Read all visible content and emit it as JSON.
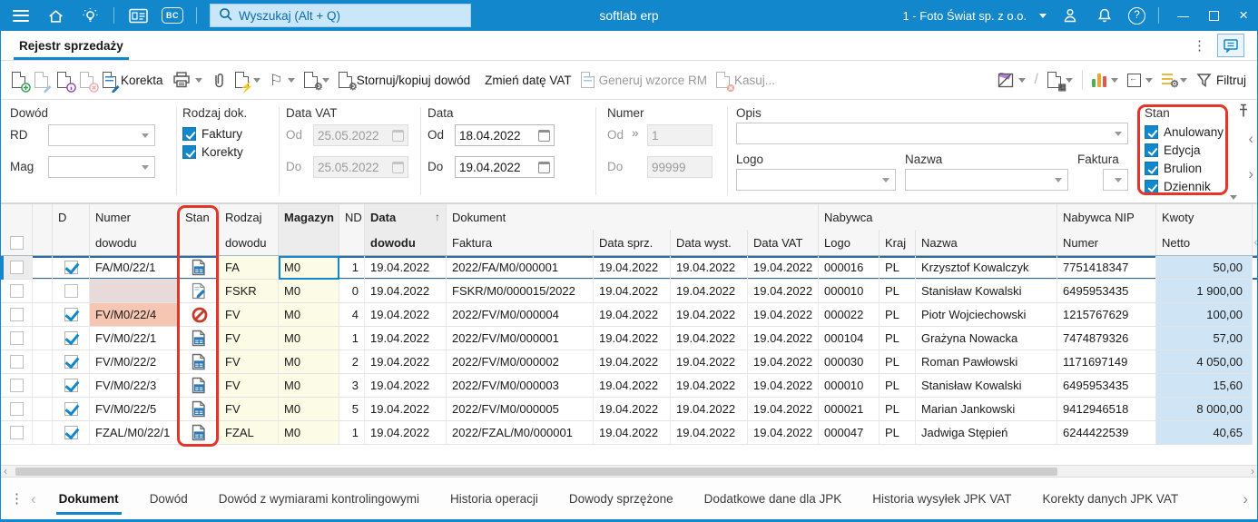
{
  "topbar": {
    "brand": "softlab erp",
    "search": {
      "placeholder": "Wyszukaj (Alt + Q)"
    },
    "company": "1 - Foto Świat sp. z o.o."
  },
  "icons": {
    "dots": "⋮",
    "chevron_left": "‹",
    "chevron_right": "›",
    "minimize": "—",
    "close": "×",
    "question": "?",
    "double_right": "»",
    "sort_asc": "↑",
    "flag": "⚐",
    "gear": "⚙",
    "bolt": "⚡",
    "grid_badge": "▦"
  },
  "tabstrip": {
    "title": "Rejestr sprzedaży"
  },
  "toolbar": {
    "korekta": "Korekta",
    "stornuj": "Stornuj/kopiuj dowód",
    "zmien_date_vat": "Zmień datę VAT",
    "generuj_wzorce": "Generuj wzorce RM",
    "kasuj": "Kasuj...",
    "filtruj": "Filtruj"
  },
  "filters": {
    "dowod": {
      "title": "Dowód",
      "rd_label": "RD",
      "mag_label": "Mag"
    },
    "rodzaj_dok": {
      "title": "Rodzaj dok.",
      "options": [
        "Faktury",
        "Korekty"
      ]
    },
    "data_vat": {
      "title": "Data VAT",
      "od_label": "Od",
      "do_label": "Do",
      "od": "25.05.2022",
      "do": "25.05.2022"
    },
    "data": {
      "title": "Data",
      "od_label": "Od",
      "do_label": "Do",
      "od": "18.04.2022",
      "do": "19.04.2022"
    },
    "numer": {
      "title": "Numer",
      "od_label": "Od",
      "do_label": "Do",
      "od": "1",
      "do": "99999"
    },
    "opis": {
      "title": "Opis"
    },
    "logo": {
      "title": "Logo"
    },
    "nazwa": {
      "title": "Nazwa"
    },
    "faktura": {
      "title": "Faktura"
    },
    "stan": {
      "title": "Stan",
      "options": [
        "Anulowany",
        "Edycja",
        "Brulion",
        "Dziennik"
      ]
    }
  },
  "table": {
    "headers": {
      "d": "D",
      "numer_1": "Numer",
      "numer_2": "dowodu",
      "stan": "Stan",
      "rodzaj_1": "Rodzaj",
      "rodzaj_2": "dowodu",
      "magazyn": "Magazyn",
      "nd": "ND",
      "data_1": "Data",
      "data_2": "dowodu",
      "dokument": "Dokument",
      "faktura": "Faktura",
      "data_sprz": "Data sprz.",
      "data_wyst": "Data wyst.",
      "data_vat": "Data VAT",
      "nabywca": "Nabywca",
      "logo": "Logo",
      "kraj": "Kraj",
      "nazwa": "Nazwa",
      "nabywca_nip": "Nabywca NIP",
      "nip_numer": "Numer",
      "kwoty": "Kwoty",
      "netto": "Netto"
    },
    "rows": [
      {
        "d": true,
        "numer": "FA/M0/22/1",
        "numer_bg": "",
        "stan": "dziennik",
        "rodzaj": "FA",
        "magazyn": "M0",
        "nd": "1",
        "data": "19.04.2022",
        "faktura": "2022/FA/M0/000001",
        "data_sprz": "19.04.2022",
        "data_wyst": "19.04.2022",
        "data_vat": "19.04.2022",
        "logo": "000016",
        "kraj": "PL",
        "nazwa": "Krzysztof Kowalczyk",
        "nip": "7751418347",
        "netto": "50,00",
        "selected": true,
        "magazyn_focus": true
      },
      {
        "d": false,
        "numer": "",
        "numer_bg": "rose",
        "stan": "edycja",
        "rodzaj": "FSKR",
        "magazyn": "M0",
        "nd": "0",
        "data": "19.04.2022",
        "faktura": "FSKR/M0/000015/2022",
        "data_sprz": "19.04.2022",
        "data_wyst": "19.04.2022",
        "data_vat": "19.04.2022",
        "logo": "000010",
        "kraj": "PL",
        "nazwa": "Stanisław Kowalski",
        "nip": "6495953435",
        "netto": "1 900,00"
      },
      {
        "d": true,
        "numer": "FV/M0/22/4",
        "numer_bg": "salmon",
        "stan": "anulowany",
        "rodzaj": "FV",
        "magazyn": "M0",
        "nd": "4",
        "data": "19.04.2022",
        "faktura": "2022/FV/M0/000004",
        "data_sprz": "19.04.2022",
        "data_wyst": "19.04.2022",
        "data_vat": "19.04.2022",
        "logo": "000022",
        "kraj": "PL",
        "nazwa": "Piotr Wojciechowski",
        "nip": "1215767629",
        "netto": "100,00"
      },
      {
        "d": true,
        "numer": "FV/M0/22/1",
        "numer_bg": "",
        "stan": "dziennik",
        "rodzaj": "FV",
        "magazyn": "M0",
        "nd": "1",
        "data": "19.04.2022",
        "faktura": "2022/FV/M0/000001",
        "data_sprz": "19.04.2022",
        "data_wyst": "19.04.2022",
        "data_vat": "19.04.2022",
        "logo": "000104",
        "kraj": "PL",
        "nazwa": "Grażyna Nowacka",
        "nip": "7474879326",
        "netto": "57,00"
      },
      {
        "d": true,
        "numer": "FV/M0/22/2",
        "numer_bg": "",
        "stan": "dziennik",
        "rodzaj": "FV",
        "magazyn": "M0",
        "nd": "2",
        "data": "19.04.2022",
        "faktura": "2022/FV/M0/000002",
        "data_sprz": "19.04.2022",
        "data_wyst": "19.04.2022",
        "data_vat": "19.04.2022",
        "logo": "000030",
        "kraj": "PL",
        "nazwa": "Roman Pawłowski",
        "nip": "1171697149",
        "netto": "4 050,00"
      },
      {
        "d": true,
        "numer": "FV/M0/22/3",
        "numer_bg": "",
        "stan": "dziennik",
        "rodzaj": "FV",
        "magazyn": "M0",
        "nd": "3",
        "data": "19.04.2022",
        "faktura": "2022/FV/M0/000003",
        "data_sprz": "19.04.2022",
        "data_wyst": "19.04.2022",
        "data_vat": "19.04.2022",
        "logo": "000010",
        "kraj": "PL",
        "nazwa": "Stanisław Kowalski",
        "nip": "6495953435",
        "netto": "15,60"
      },
      {
        "d": true,
        "numer": "FV/M0/22/5",
        "numer_bg": "",
        "stan": "dziennik",
        "rodzaj": "FV",
        "magazyn": "M0",
        "nd": "5",
        "data": "19.04.2022",
        "faktura": "2022/FV/M0/000005",
        "data_sprz": "19.04.2022",
        "data_wyst": "19.04.2022",
        "data_vat": "19.04.2022",
        "logo": "000021",
        "kraj": "PL",
        "nazwa": "Marian Jankowski",
        "nip": "9412946518",
        "netto": "8 000,00"
      },
      {
        "d": true,
        "numer": "FZAL/M0/22/1",
        "numer_bg": "",
        "stan": "dziennik",
        "rodzaj": "FZAL",
        "magazyn": "M0",
        "nd": "1",
        "data": "19.04.2022",
        "faktura": "2022/FZAL/M0/000001",
        "data_sprz": "19.04.2022",
        "data_wyst": "19.04.2022",
        "data_vat": "19.04.2022",
        "logo": "000047",
        "kraj": "PL",
        "nazwa": "Jadwiga Stępień",
        "nip": "6244422539",
        "netto": "40,65"
      }
    ]
  },
  "bottom_tabs": {
    "active": 0,
    "items": [
      "Dokument",
      "Dowód",
      "Dowód z wymiarami kontrolingowymi",
      "Historia operacji",
      "Dowody sprzężone",
      "Dodatkowe dane dla JPK",
      "Historia wysyłek JPK VAT",
      "Korekty danych JPK VAT"
    ]
  }
}
